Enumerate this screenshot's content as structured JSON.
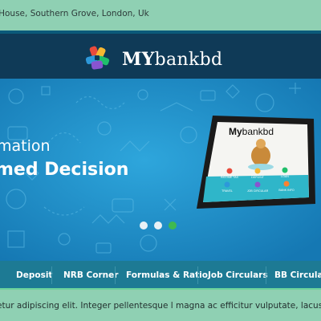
{
  "topbar": {
    "address": "nt House, Southern Grove, London, Uk"
  },
  "header": {
    "brand_bold": "MY",
    "brand_rest": "bankbd"
  },
  "hero": {
    "line1": "mation",
    "line2": "med Decision",
    "tablet": {
      "title_bold": "My",
      "title_rest": "bankbd",
      "buttons": [
        "INCOME TAX",
        "DEPOSIT",
        "LOAN",
        "TRAVEL",
        "JOB CIRCULAR",
        "BANK INFO"
      ]
    },
    "slider": {
      "count": 3,
      "active_index": 2
    }
  },
  "nav": {
    "items": [
      "Deposit",
      "NRB Corner",
      "Formulas & Ratio",
      "Job Circulars",
      "BB Circulars"
    ]
  },
  "ticker": {
    "text": "etur adipiscing elit. Integer pellentesque l magna ac efficitur vulputate, lacus tortor cons"
  },
  "colors": {
    "topbar": "#8fd0b3",
    "header": "#0f3a57",
    "hero": "#1f8fc9",
    "nav": "#1d7a94",
    "slider_active": "#3fb950"
  }
}
